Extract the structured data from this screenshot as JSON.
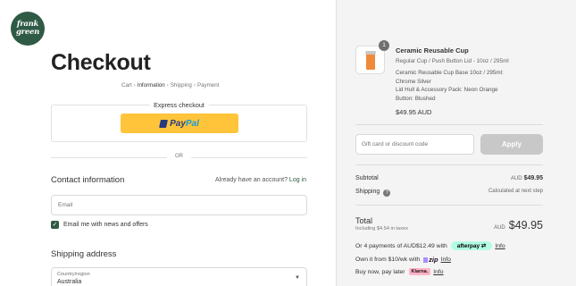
{
  "brand": {
    "logo_line1": "frank",
    "logo_line2": "green"
  },
  "page": {
    "title": "Checkout"
  },
  "breadcrumb": {
    "items": [
      "Cart",
      "Information",
      "Shipping",
      "Payment"
    ]
  },
  "express": {
    "label": "Express checkout",
    "paypal_pay": "Pay",
    "paypal_pal": "Pal",
    "divider_text": "OR"
  },
  "contact": {
    "title": "Contact information",
    "login_prompt": "Already have an account?",
    "login_link": "Log in",
    "email_placeholder": "Email",
    "newsletter_label": "Email me with news and offers",
    "newsletter_checked": true
  },
  "shipping": {
    "title": "Shipping address",
    "country_label": "Country/region",
    "country_value": "Australia"
  },
  "cart": {
    "item": {
      "quantity": "1",
      "name": "Ceramic Reusable Cup",
      "variant": "Regular Cup / Push Button Lid - 10oz / 295ml",
      "options": [
        "Ceramic Reusable Cup Base 10oz / 295ml:",
        "Chrome Silver",
        "Lid Hull & Accessory Pack: Neon Orange",
        "Button: Blushed"
      ],
      "price": "$49.95 AUD"
    },
    "discount_placeholder": "Gift card or discount code",
    "apply_label": "Apply",
    "subtotal_label": "Subtotal",
    "subtotal_currency": "AUD",
    "subtotal_value": "$49.95",
    "shipping_label": "Shipping",
    "shipping_value": "Calculated at next step",
    "total_label": "Total",
    "taxes_note": "Including $4.54 in taxes",
    "total_currency": "AUD",
    "total_value": "$49.95"
  },
  "payment_options": {
    "afterpay_text": "Or 4 payments of AUD$12.49 with",
    "afterpay_brand": "afterpay",
    "zip_text": "Own it from $10/wk with",
    "zip_brand": "zip",
    "klarna_text": "Buy now, pay later",
    "klarna_brand": "Klarna.",
    "info_link": "Info"
  },
  "colors": {
    "brand_green": "#2f5a45",
    "paypal_yellow": "#ffc439",
    "afterpay_mint": "#b2fce4",
    "klarna_pink": "#ffb3c7"
  }
}
